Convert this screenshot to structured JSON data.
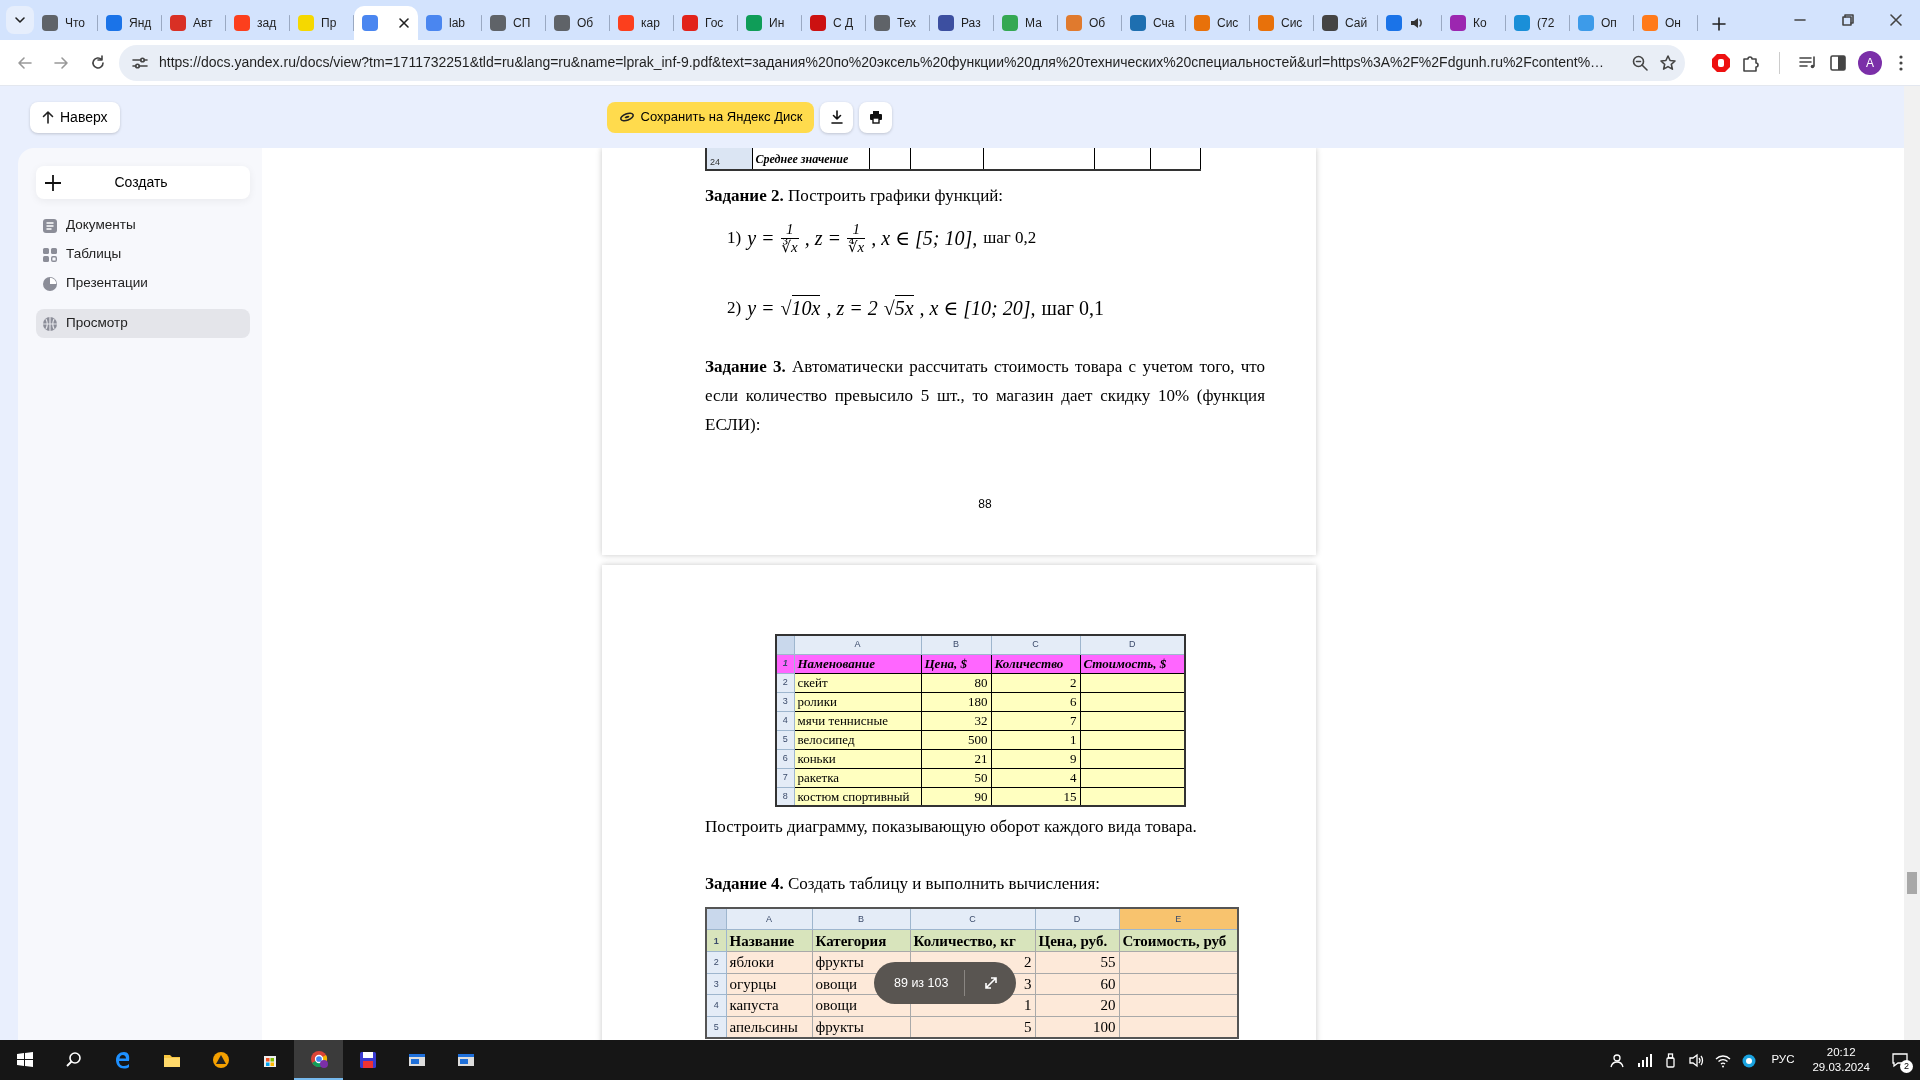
{
  "browser": {
    "tabs": [
      {
        "kind": "page",
        "label": "Что",
        "color": "#5f6368",
        "selected": false
      },
      {
        "kind": "page",
        "label": "Янд",
        "color": "#1a73e8",
        "selected": false
      },
      {
        "kind": "page",
        "label": "Авт",
        "color": "#d93025",
        "selected": false
      },
      {
        "kind": "page",
        "label": "зад",
        "color": "#fc3f1d",
        "selected": false
      },
      {
        "kind": "page",
        "label": "Пр",
        "color": "#f5d800",
        "selected": false
      },
      {
        "kind": "page",
        "color": "#4a86f0",
        "selected": true
      },
      {
        "kind": "page",
        "label": "lab",
        "color": "#4a86f0",
        "selected": false
      },
      {
        "kind": "page",
        "label": "СП",
        "color": "#5f6368",
        "selected": false
      },
      {
        "kind": "page",
        "label": "Об",
        "color": "#5f6368",
        "selected": false
      },
      {
        "kind": "page",
        "label": "кар",
        "color": "#fc3f1d",
        "selected": false
      },
      {
        "kind": "page",
        "label": "Гос",
        "color": "#e2231a",
        "selected": false
      },
      {
        "kind": "page",
        "label": "Ин",
        "color": "#0f9d58",
        "selected": false
      },
      {
        "kind": "page",
        "label": "С Д",
        "color": "#cc1111",
        "selected": false
      },
      {
        "kind": "page",
        "label": "Тех",
        "color": "#5f6368",
        "selected": false
      },
      {
        "kind": "page",
        "label": "Раз",
        "color": "#3c4fa0",
        "selected": false
      },
      {
        "kind": "page",
        "label": "Ма",
        "color": "#34a853",
        "selected": false
      },
      {
        "kind": "page",
        "label": "Об",
        "color": "#e07a2e",
        "selected": false
      },
      {
        "kind": "page",
        "label": "Сча",
        "color": "#1e6fb0",
        "selected": false
      },
      {
        "kind": "page",
        "label": "Сис",
        "color": "#e8710a",
        "selected": false
      },
      {
        "kind": "page",
        "label": "Сис",
        "color": "#e8710a",
        "selected": false
      },
      {
        "kind": "page",
        "label": "Сай",
        "color": "#444444",
        "selected": false
      },
      {
        "kind": "audio",
        "color": "#1a73e8",
        "selected": false
      },
      {
        "kind": "page",
        "label": "Ко",
        "color": "#9c27b0",
        "selected": false
      },
      {
        "kind": "page",
        "label": "(72",
        "color": "#1a8fd8",
        "selected": false
      },
      {
        "kind": "page",
        "label": "Оп",
        "color": "#3d9be9",
        "selected": false
      },
      {
        "kind": "page",
        "label": "Он",
        "color": "#ff7a1a",
        "selected": false
      }
    ],
    "address": "https://docs.yandex.ru/docs/view?tm=1711732251&tld=ru&lang=ru&name=lprak_inf-9.pdf&text=задания%20по%20эксель%20функции%20для%20технических%20специальностей&url=https%3A%2F%2Fdgunh.ru%2Fcontent%…",
    "profile": "A"
  },
  "toolbar": {
    "back_to_top": "Наверх",
    "save": "Сохранить на Яндекс Диск"
  },
  "sidebar": {
    "create": "Создать",
    "items": [
      {
        "kind": "documents",
        "label": "Документы",
        "selected": false
      },
      {
        "kind": "spreadsheets",
        "label": "Таблицы",
        "selected": false
      },
      {
        "kind": "presentations",
        "label": "Презентации",
        "selected": false
      },
      {
        "kind": "viewer",
        "label": "Просмотр",
        "selected": true
      }
    ]
  },
  "page_1": {
    "table_tail": {
      "row_number": "24",
      "label": "Среднее значение"
    },
    "task_2": "**Задание 2.** Построить графики функций:",
    "formulas": [
      {
        "number": "1)",
        "parts": [
          {
            "kind": "text",
            "text": "y ="
          },
          {
            "kind": "frac",
            "num": "1",
            "den": "∛x"
          },
          {
            "kind": "text",
            "text": ", z ="
          },
          {
            "kind": "frac",
            "num": "1",
            "den": "∜x"
          },
          {
            "kind": "text",
            "text": ", x ∈ [5; 10],"
          },
          {
            "kind": "plain",
            "text": "шаг 0,2"
          }
        ]
      },
      {
        "number": "2)",
        "parts": [
          {
            "kind": "text",
            "text": "y ="
          },
          {
            "kind": "sqrt",
            "sign": "√",
            "text": "10x"
          },
          {
            "kind": "text",
            "text": ", z = 2"
          },
          {
            "kind": "sqrt",
            "sign": "√",
            "text": "5x"
          },
          {
            "kind": "text",
            "text": ", x ∈ [10; 20],"
          },
          {
            "kind": "plain",
            "text": "шаг 0,1"
          }
        ]
      }
    ],
    "task_3": "**Задание 3.** Автоматически рассчитать стоимость товара с учетом того, что если количество превысило 5 шт., то магазин дает скидку 10% (функция ЕСЛИ):",
    "page_number": "88"
  },
  "page_2": {
    "table_1": {
      "columns": [
        {
          "label": "A",
          "kind": "text"
        },
        {
          "label": "B",
          "kind": "number"
        },
        {
          "label": "C",
          "kind": "number"
        },
        {
          "label": "D",
          "kind": "text"
        }
      ],
      "rows": [
        {
          "number": "1",
          "kind": "header",
          "cells": [
            "Наменование",
            "Цена, $",
            "Количество",
            "Стоимость, $"
          ]
        },
        {
          "number": "2",
          "kind": "data",
          "cells": [
            "скейт",
            "80",
            "2"
          ]
        },
        {
          "number": "3",
          "kind": "data",
          "cells": [
            "ролики",
            "180",
            "6"
          ]
        },
        {
          "number": "4",
          "kind": "data",
          "cells": [
            "мячи теннисные",
            "32",
            "7"
          ]
        },
        {
          "number": "5",
          "kind": "data",
          "cells": [
            "велосипед",
            "500",
            "1"
          ]
        },
        {
          "number": "6",
          "kind": "data",
          "cells": [
            "коньки",
            "21",
            "9"
          ]
        },
        {
          "number": "7",
          "kind": "data",
          "cells": [
            "ракетка",
            "50",
            "4"
          ]
        },
        {
          "number": "8",
          "kind": "data",
          "cells": [
            "костюм спортивный",
            "90",
            "15"
          ]
        }
      ]
    },
    "note": "Построить диаграмму, показывающую оборот каждого вида товара.",
    "task_4": "**Задание 4.** Создать таблицу и выполнить вычисления:",
    "table_2": {
      "columns": [
        {
          "label": "A",
          "kind": "text",
          "selected": false
        },
        {
          "label": "B",
          "kind": "text",
          "selected": false
        },
        {
          "label": "C",
          "kind": "number",
          "selected": false
        },
        {
          "label": "D",
          "kind": "number",
          "selected": false
        },
        {
          "label": "E",
          "kind": "text",
          "selected": true
        }
      ],
      "rows": [
        {
          "number": "1",
          "kind": "header",
          "cells": [
            "Название",
            "Категория",
            "Количество, кг",
            "Цена, руб.",
            "Стоимость, руб"
          ]
        },
        {
          "number": "2",
          "kind": "data",
          "cells": [
            "яблоки",
            "фрукты",
            "2",
            "55"
          ]
        },
        {
          "number": "3",
          "kind": "data",
          "cells": [
            "огурцы",
            "овощи",
            "3",
            "60"
          ]
        },
        {
          "number": "4",
          "kind": "data",
          "cells": [
            "капуста",
            "овощи",
            "1",
            "20"
          ]
        },
        {
          "number": "5",
          "kind": "data",
          "cells": [
            "апельсины",
            "фрукты",
            "5",
            "100"
          ]
        }
      ]
    }
  },
  "pager": {
    "text": "89 из 103"
  },
  "taskbar": {
    "language": "РУС",
    "time": "20:12",
    "date": "29.03.2024",
    "notifications": "2"
  }
}
